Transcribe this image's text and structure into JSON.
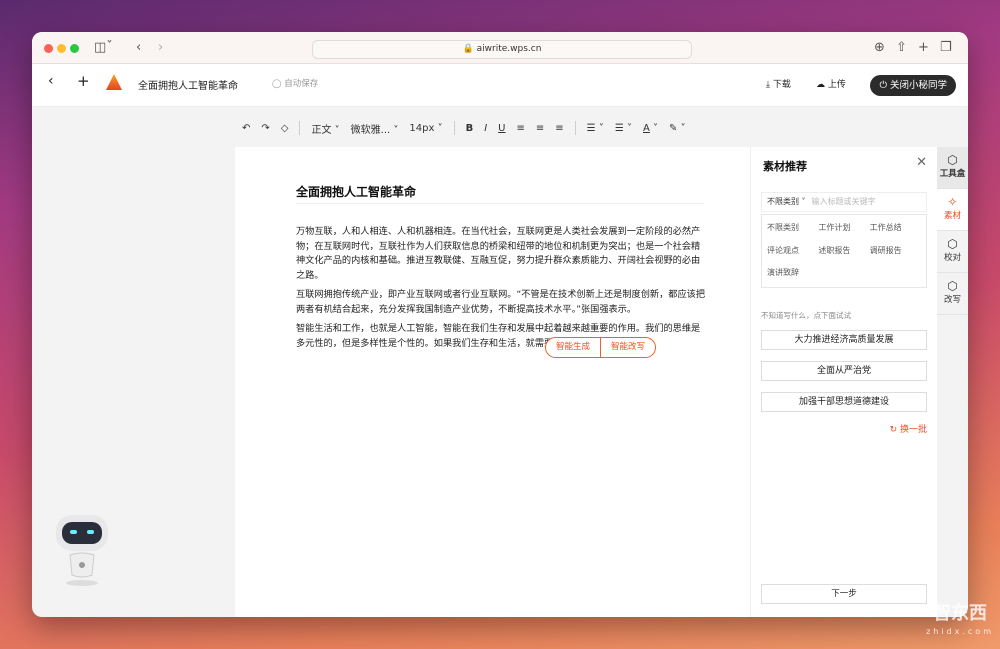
{
  "browser": {
    "url": "aiwrite.wps.cn"
  },
  "app": {
    "doc_title": "全面拥抱人工智能革命",
    "autosave": "自动保存",
    "download": "下载",
    "upload": "上传",
    "close_assistant": "关闭小秘同学"
  },
  "toolbar": {
    "style": "正文",
    "font": "微软雅...",
    "size": "14px"
  },
  "document": {
    "title": "全面拥抱人工智能革命",
    "paragraphs": [
      "万物互联，人和人相连、人和机器相连。在当代社会，互联网更是人类社会发展到一定阶段的必然产物；在互联网时代，互联社作为人们获取信息的桥梁和纽带的地位和机制更为突出；也是一个社会精神文化产品的内核和基础。推进互教联健、互融互促，努力提升群众素质能力、开阔社会视野的必由之路。",
      "互联网拥抱传统产业，即产业互联网或者行业互联网。“不管是在技术创新上还是制度创新，都应该把两者有机结合起来，充分发挥我国制造产业优势，不断提高技术水平。”张国强表示。",
      "智能生活和工作，也就是人工智能，智能在我们生存和发展中起着越来越重要的作用。我们的思维是多元性的，但是多样性是个性的。如果我们生存和生活，就需要创"
    ],
    "popup": {
      "generate": "智能生成",
      "rewrite": "智能改写"
    }
  },
  "panel": {
    "title": "素材推荐",
    "category": "不限类别",
    "search_placeholder": "输入标题或关键字",
    "categories": [
      "不限类别",
      "工作计划",
      "工作总结",
      "评论观点",
      "述职报告",
      "调研报告",
      "演讲致辞"
    ],
    "hint": "不知道写什么，点下面试试",
    "suggestions": [
      "大力推进经济高质量发展",
      "全面从严治党",
      "加强干部思想道德建设"
    ],
    "refresh": "换一批",
    "next": "下一步"
  },
  "sidebar": [
    {
      "label": "工具盒",
      "icon": "toolbox-icon"
    },
    {
      "label": "素材",
      "icon": "material-icon"
    },
    {
      "label": "校对",
      "icon": "proofread-icon"
    },
    {
      "label": "改写",
      "icon": "rewrite-icon"
    }
  ],
  "colors": {
    "accent": "#e85020",
    "dark_button": "#2b2b2b"
  },
  "watermark": {
    "text": "智东西",
    "sub": "zhidx.com"
  }
}
